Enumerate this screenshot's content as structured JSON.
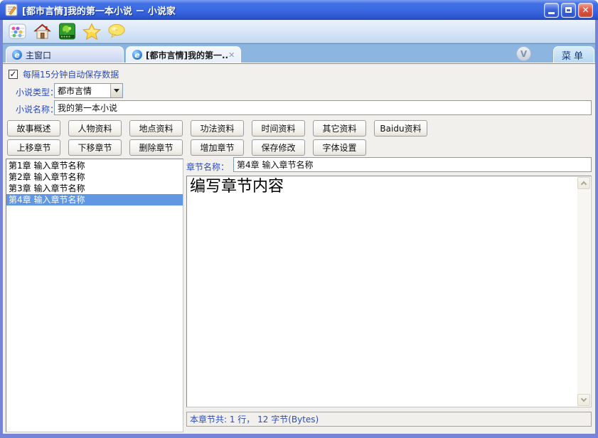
{
  "window": {
    "title": "[都市言情]我的第一本小说 － 小说家",
    "close_glyph": "✕"
  },
  "toolbar": {
    "icons": {
      "abacus-icon": "abacus toolbar shortcut",
      "home-icon": "home toolbar shortcut",
      "game-icon": "green game toolbar shortcut",
      "star-icon": "favorites star",
      "chat-icon": "yellow speech bubble"
    }
  },
  "tabbar": {
    "main_tab": "主窗口",
    "novel_tab": "[都市言情]我的第一..",
    "novel_tab_close": "✕",
    "dropdown_glyph": "V",
    "menu_button": "菜单"
  },
  "autosave": {
    "checkmark": "✓",
    "label": "每隔15分钟自动保存数据",
    "checked": true
  },
  "novel": {
    "type_label": "小说类型：",
    "type_value": "都市言情",
    "name_label": "小说名称：",
    "name_value": "我的第一本小说"
  },
  "buttons": {
    "row1": [
      "故事概述",
      "人物资料",
      "地点资料",
      "功法资料",
      "时间资料",
      "其它资料",
      "Baidu资料"
    ],
    "row2": [
      "上移章节",
      "下移章节",
      "删除章节",
      "增加章节",
      "保存修改",
      "字体设置"
    ]
  },
  "chapters": {
    "items": [
      "第1章 输入章节名称",
      "第2章 输入章节名称",
      "第3章 输入章节名称",
      "第4章 输入章节名称"
    ],
    "selected_index": 3
  },
  "editor": {
    "chapter_name_label": "章节名称：",
    "chapter_name_value": "第4章 输入章节名称",
    "content": "编写章节内容"
  },
  "statusbar": {
    "text": "本章节共: 1 行， 12 字节(Bytes)"
  },
  "colors": {
    "titlebar_blue": "#3a67e0",
    "window_border": "#7584d9",
    "tabbar_blue": "#8cb6e0",
    "label_blue": "#2b4bbf",
    "selection_blue": "#5f97e3",
    "close_red": "#dd5a44"
  }
}
